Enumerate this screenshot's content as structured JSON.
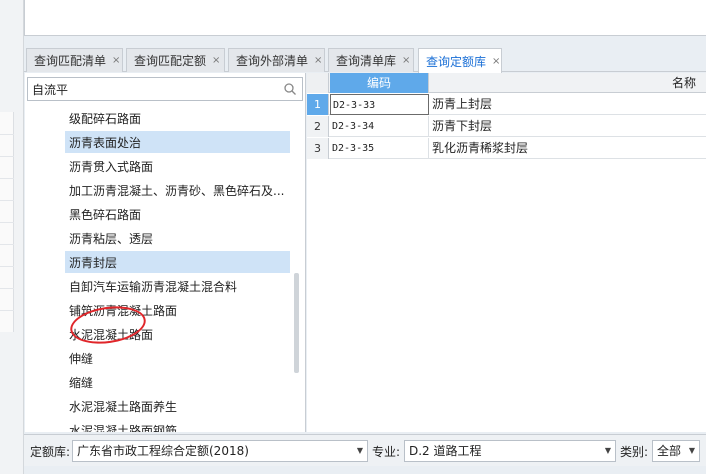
{
  "tabs": [
    {
      "label": "查询匹配清单",
      "close": "×",
      "active": false
    },
    {
      "label": "查询匹配定额",
      "close": "×",
      "active": false
    },
    {
      "label": "查询外部清单",
      "close": "×",
      "active": false
    },
    {
      "label": "查询清单库",
      "close": "×",
      "active": false
    },
    {
      "label": "查询定额库",
      "close": "×",
      "active": true
    }
  ],
  "search": {
    "value": "自流平",
    "icon": "search-icon"
  },
  "tree": [
    {
      "label": "级配碎石路面",
      "selected": false
    },
    {
      "label": "沥青表面处治",
      "selected": true
    },
    {
      "label": "沥青贯入式路面",
      "selected": false
    },
    {
      "label": "加工沥青混凝土、沥青砂、黑色碎石及...",
      "selected": false
    },
    {
      "label": "黑色碎石路面",
      "selected": false
    },
    {
      "label": "沥青粘层、透层",
      "selected": false
    },
    {
      "label": "沥青封层",
      "selected": true
    },
    {
      "label": "自卸汽车运输沥青混凝土混合料",
      "selected": false
    },
    {
      "label": "铺筑沥青混凝土路面",
      "selected": false
    },
    {
      "label": "水泥混凝土路面",
      "selected": false
    },
    {
      "label": "伸缝",
      "selected": false
    },
    {
      "label": "缩缝",
      "selected": false
    },
    {
      "label": "水泥混凝土路面养生",
      "selected": false
    },
    {
      "label": "水泥混凝土路面钢筋",
      "selected": false
    }
  ],
  "grid": {
    "headers": {
      "code": "编码",
      "name": "名称"
    },
    "rows": [
      {
        "num": "1",
        "code": "D2-3-33",
        "name": "沥青上封层"
      },
      {
        "num": "2",
        "code": "D2-3-34",
        "name": "沥青下封层"
      },
      {
        "num": "3",
        "code": "D2-3-35",
        "name": "乳化沥青稀浆封层"
      }
    ]
  },
  "bottom": {
    "quota_label": "定额库:",
    "quota_value": "广东省市政工程综合定额(2018)",
    "major_label": "专业:",
    "major_value": "D.2 道路工程",
    "category_label": "类别:",
    "category_value": "全部",
    "caret": "▼"
  },
  "colors": {
    "accent": "#1a6fd6",
    "header_blue": "#5fa9ea",
    "selection": "#cfe3f7",
    "annotation_red": "#e0262a"
  }
}
